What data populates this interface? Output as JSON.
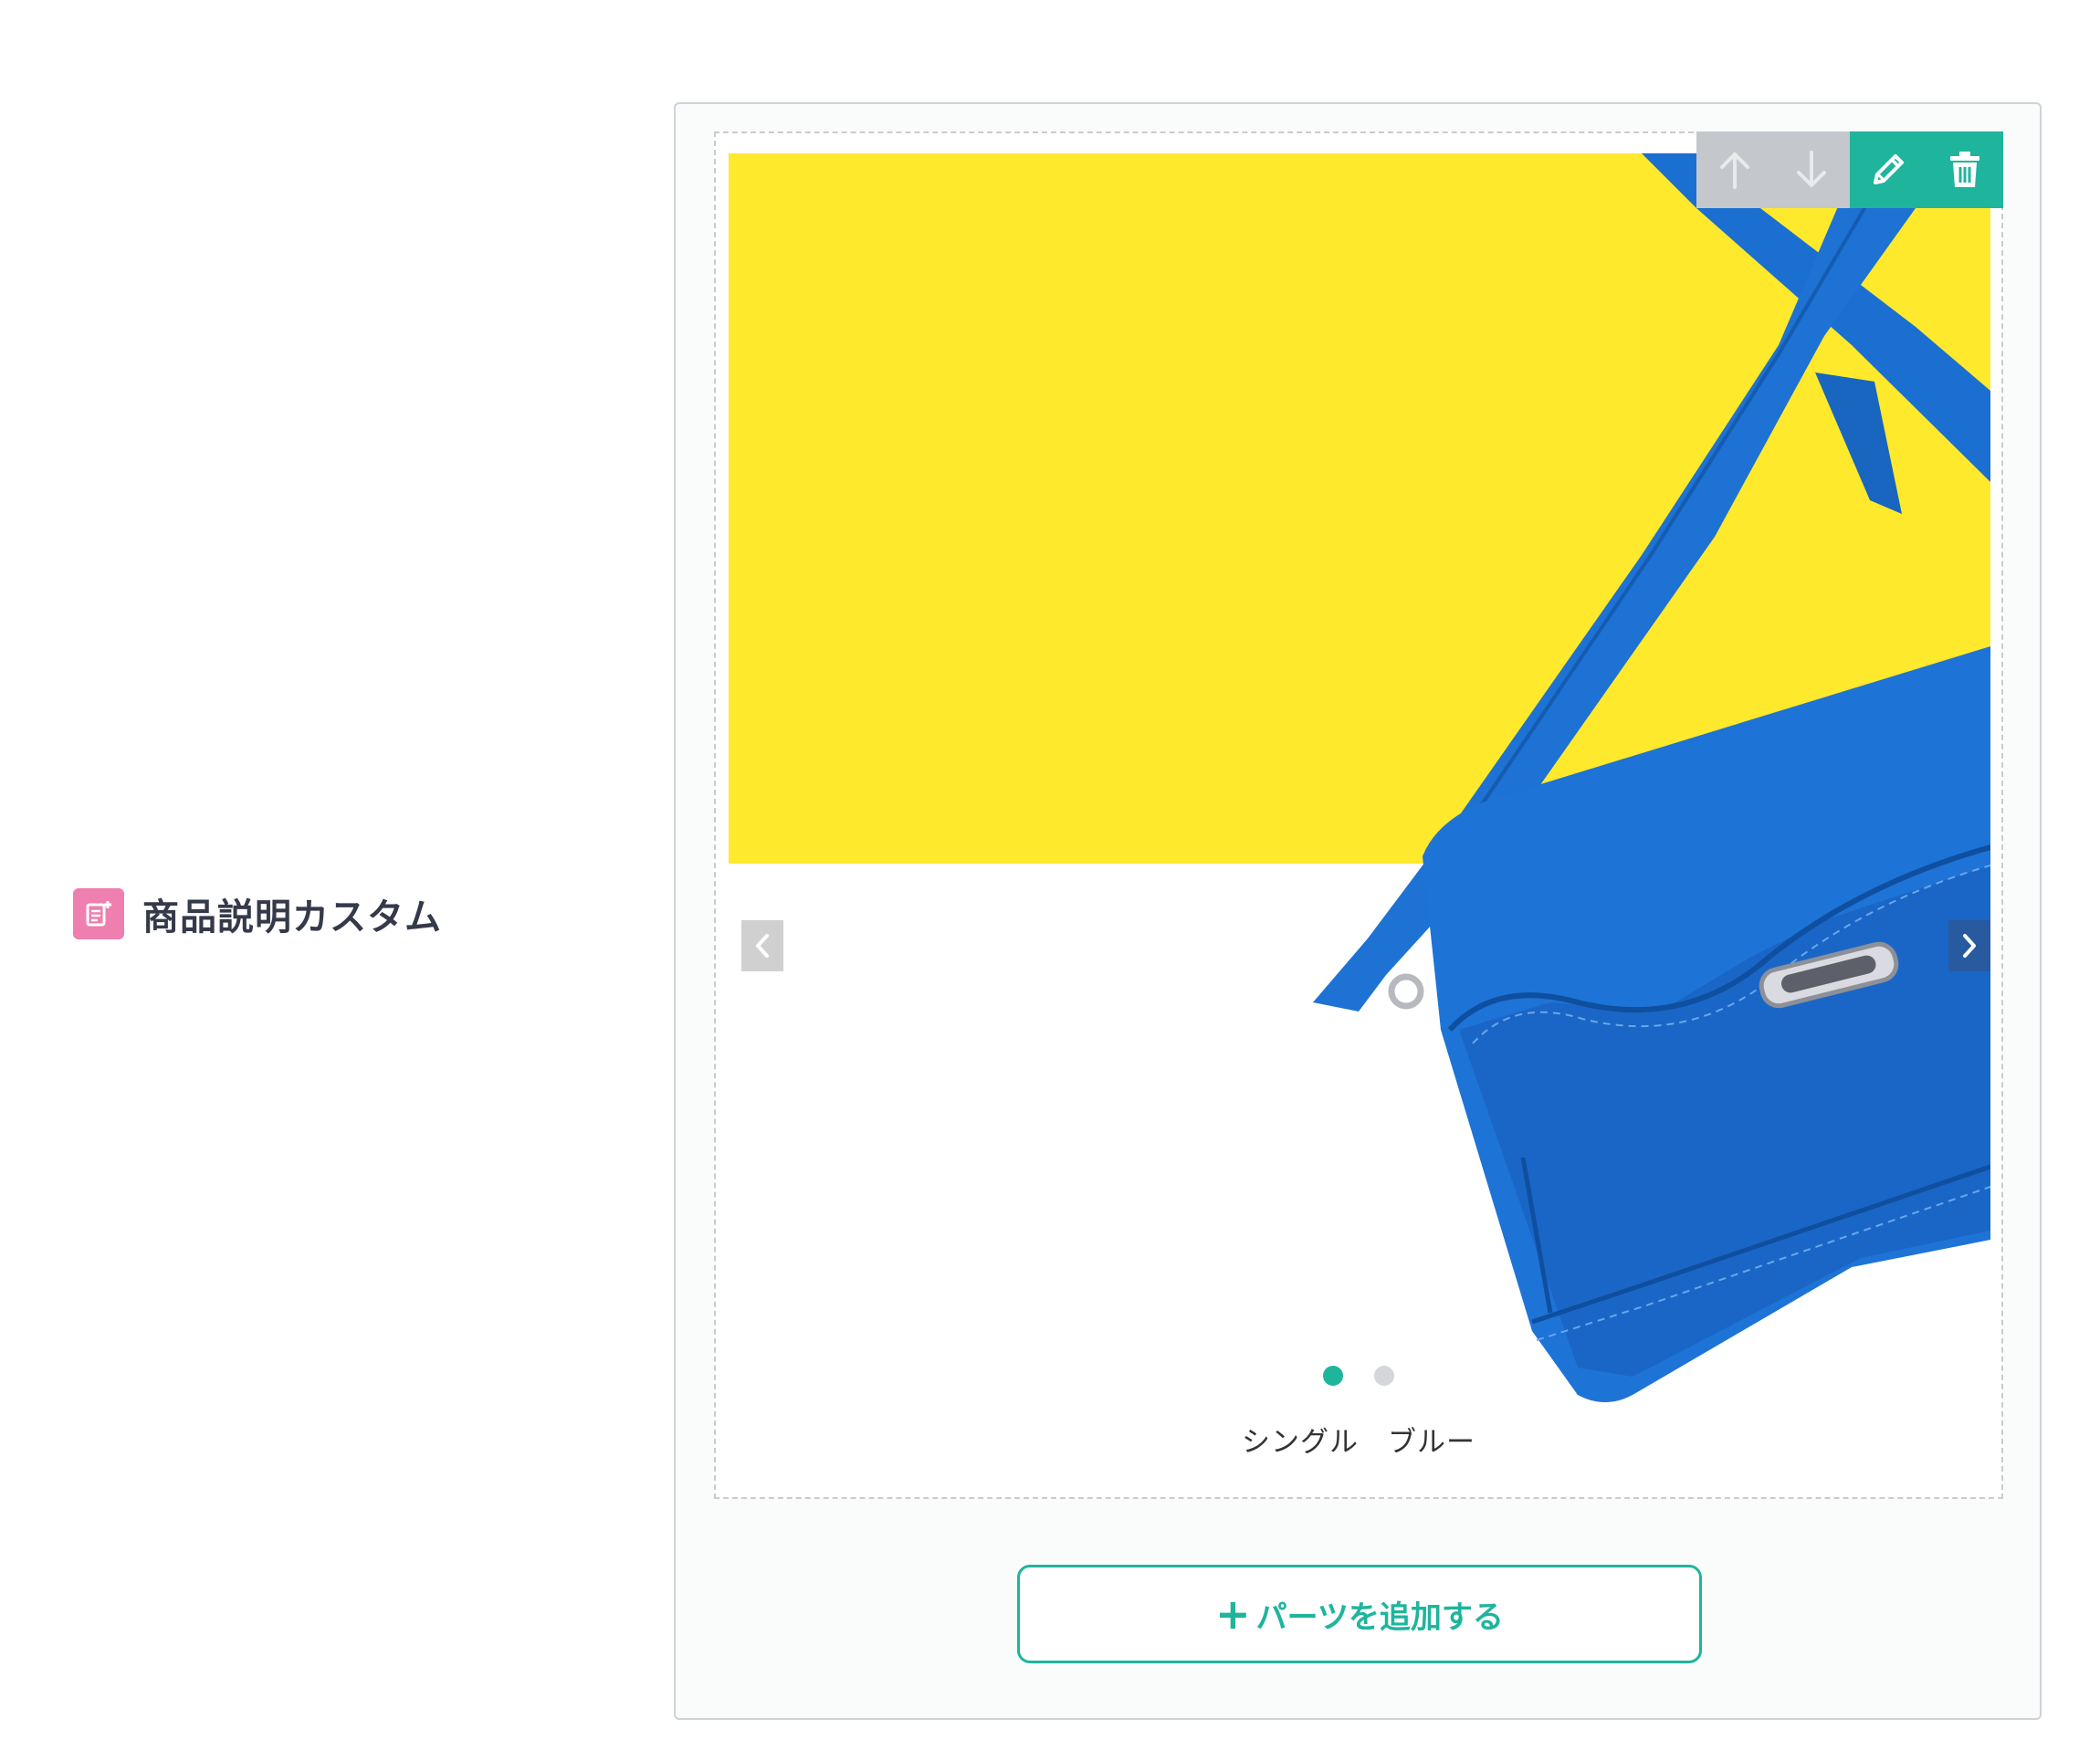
{
  "section": {
    "icon": "document-add-icon",
    "title": "商品説明カスタム",
    "icon_color": "#ee7fae"
  },
  "part_toolbar": {
    "move_up_icon": "arrow-up-icon",
    "move_down_icon": "arrow-down-icon",
    "edit_icon": "pencil-icon",
    "delete_icon": "trash-icon",
    "move_color": "#c4c7cc",
    "action_color": "#1fb59d"
  },
  "slider": {
    "image": "blue-leather-shoulder-bag-on-yellow-and-white-background",
    "prev_icon": "chevron-left-icon",
    "next_icon": "chevron-right-icon",
    "slide_count": 2,
    "active_slide": 1,
    "caption": "シングル　ブルー"
  },
  "add_parts": {
    "icon": "plus-icon",
    "label": "パーツを追加する"
  },
  "colors": {
    "accent": "#1fb59d",
    "photo_yellow": "#ffe92c",
    "bag_blue": "#1e73d6"
  }
}
